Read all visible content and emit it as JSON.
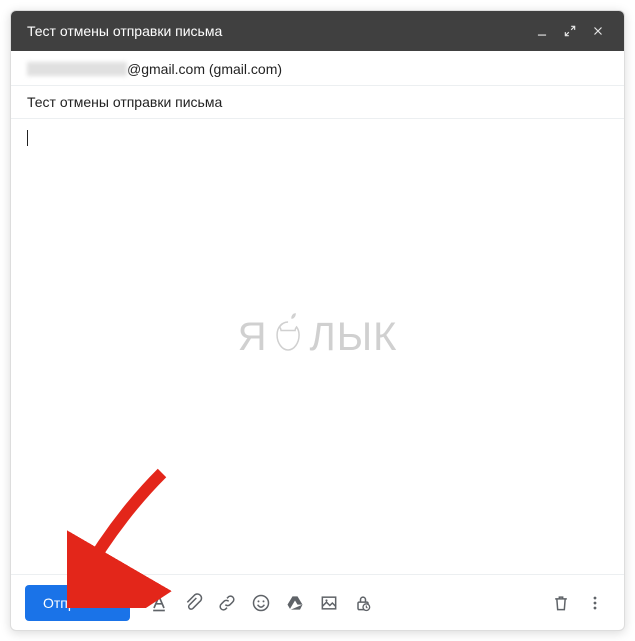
{
  "header": {
    "title": "Тест отмены отправки письма"
  },
  "to": {
    "display": "@gmail.com (gmail.com)"
  },
  "subject": {
    "value": "Тест отмены отправки письма"
  },
  "watermark": {
    "left": "Я",
    "right": "ЛЫК"
  },
  "toolbar": {
    "send_label": "Отправить"
  },
  "icons": {
    "minimize": "minimize",
    "expand": "expand",
    "close": "close",
    "format": "format",
    "attach": "attach",
    "link": "link",
    "emoji": "emoji",
    "drive": "drive",
    "image": "image",
    "confidential": "confidential",
    "trash": "trash",
    "more": "more"
  }
}
